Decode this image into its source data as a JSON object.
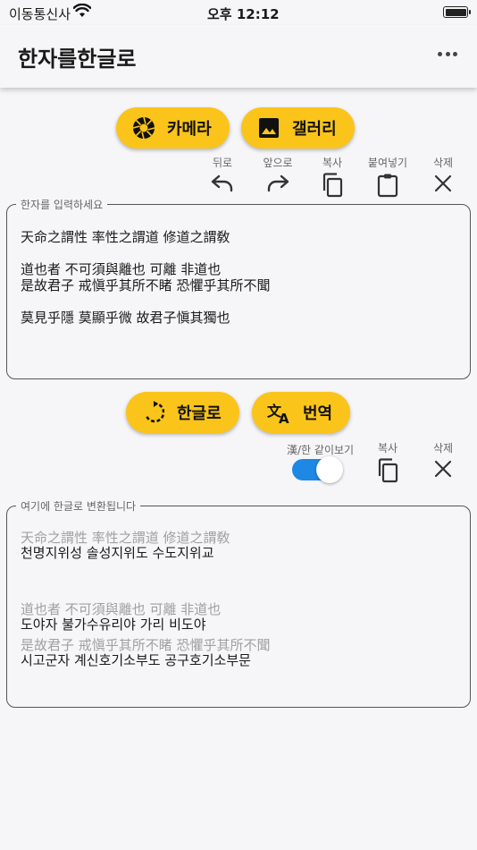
{
  "status": {
    "carrier": "이동통신사",
    "time": "오후 12:12"
  },
  "appbar": {
    "title": "한자를한글로"
  },
  "top_buttons": {
    "camera": "카메라",
    "gallery": "갤러리"
  },
  "input_actions": {
    "undo": "뒤로",
    "redo": "앞으로",
    "copy": "복사",
    "paste": "붙여넣기",
    "delete": "삭제"
  },
  "input": {
    "legend": "한자를 입력하세요",
    "lines": [
      "天命之謂性 率性之謂道 修道之謂敎",
      "道也者 不可須與離也 可離 非道也",
      "是故君子 戒愼乎其所不睹 恐懼乎其所不聞",
      "莫見乎隱 莫顯乎微 故君子愼其獨也"
    ]
  },
  "mid_buttons": {
    "hangul": "한글로",
    "translate": "번역"
  },
  "output_actions": {
    "toggle_label": "漢/한 같이보기",
    "toggle_on": true,
    "copy": "복사",
    "delete": "삭제"
  },
  "output": {
    "legend": "여기에 한글로 변환됩니다",
    "hanja1": "天命之謂性 率性之謂道 修道之謂敎",
    "hangul1": "천명지위성 솔성지위도 수도지위교",
    "hanja2": "道也者 不可須與離也 可離 非道也",
    "hangul2": "도야자 불가수유리야 가리 비도야",
    "hanja3": "是故君子 戒愼乎其所不睹 恐懼乎其所不聞",
    "hangul3": "시고군자 계신호기소부도 공구호기소부문"
  },
  "colors": {
    "accent": "#fbc41a",
    "toggle": "#1e88e5",
    "background": "#f6f6f8"
  }
}
